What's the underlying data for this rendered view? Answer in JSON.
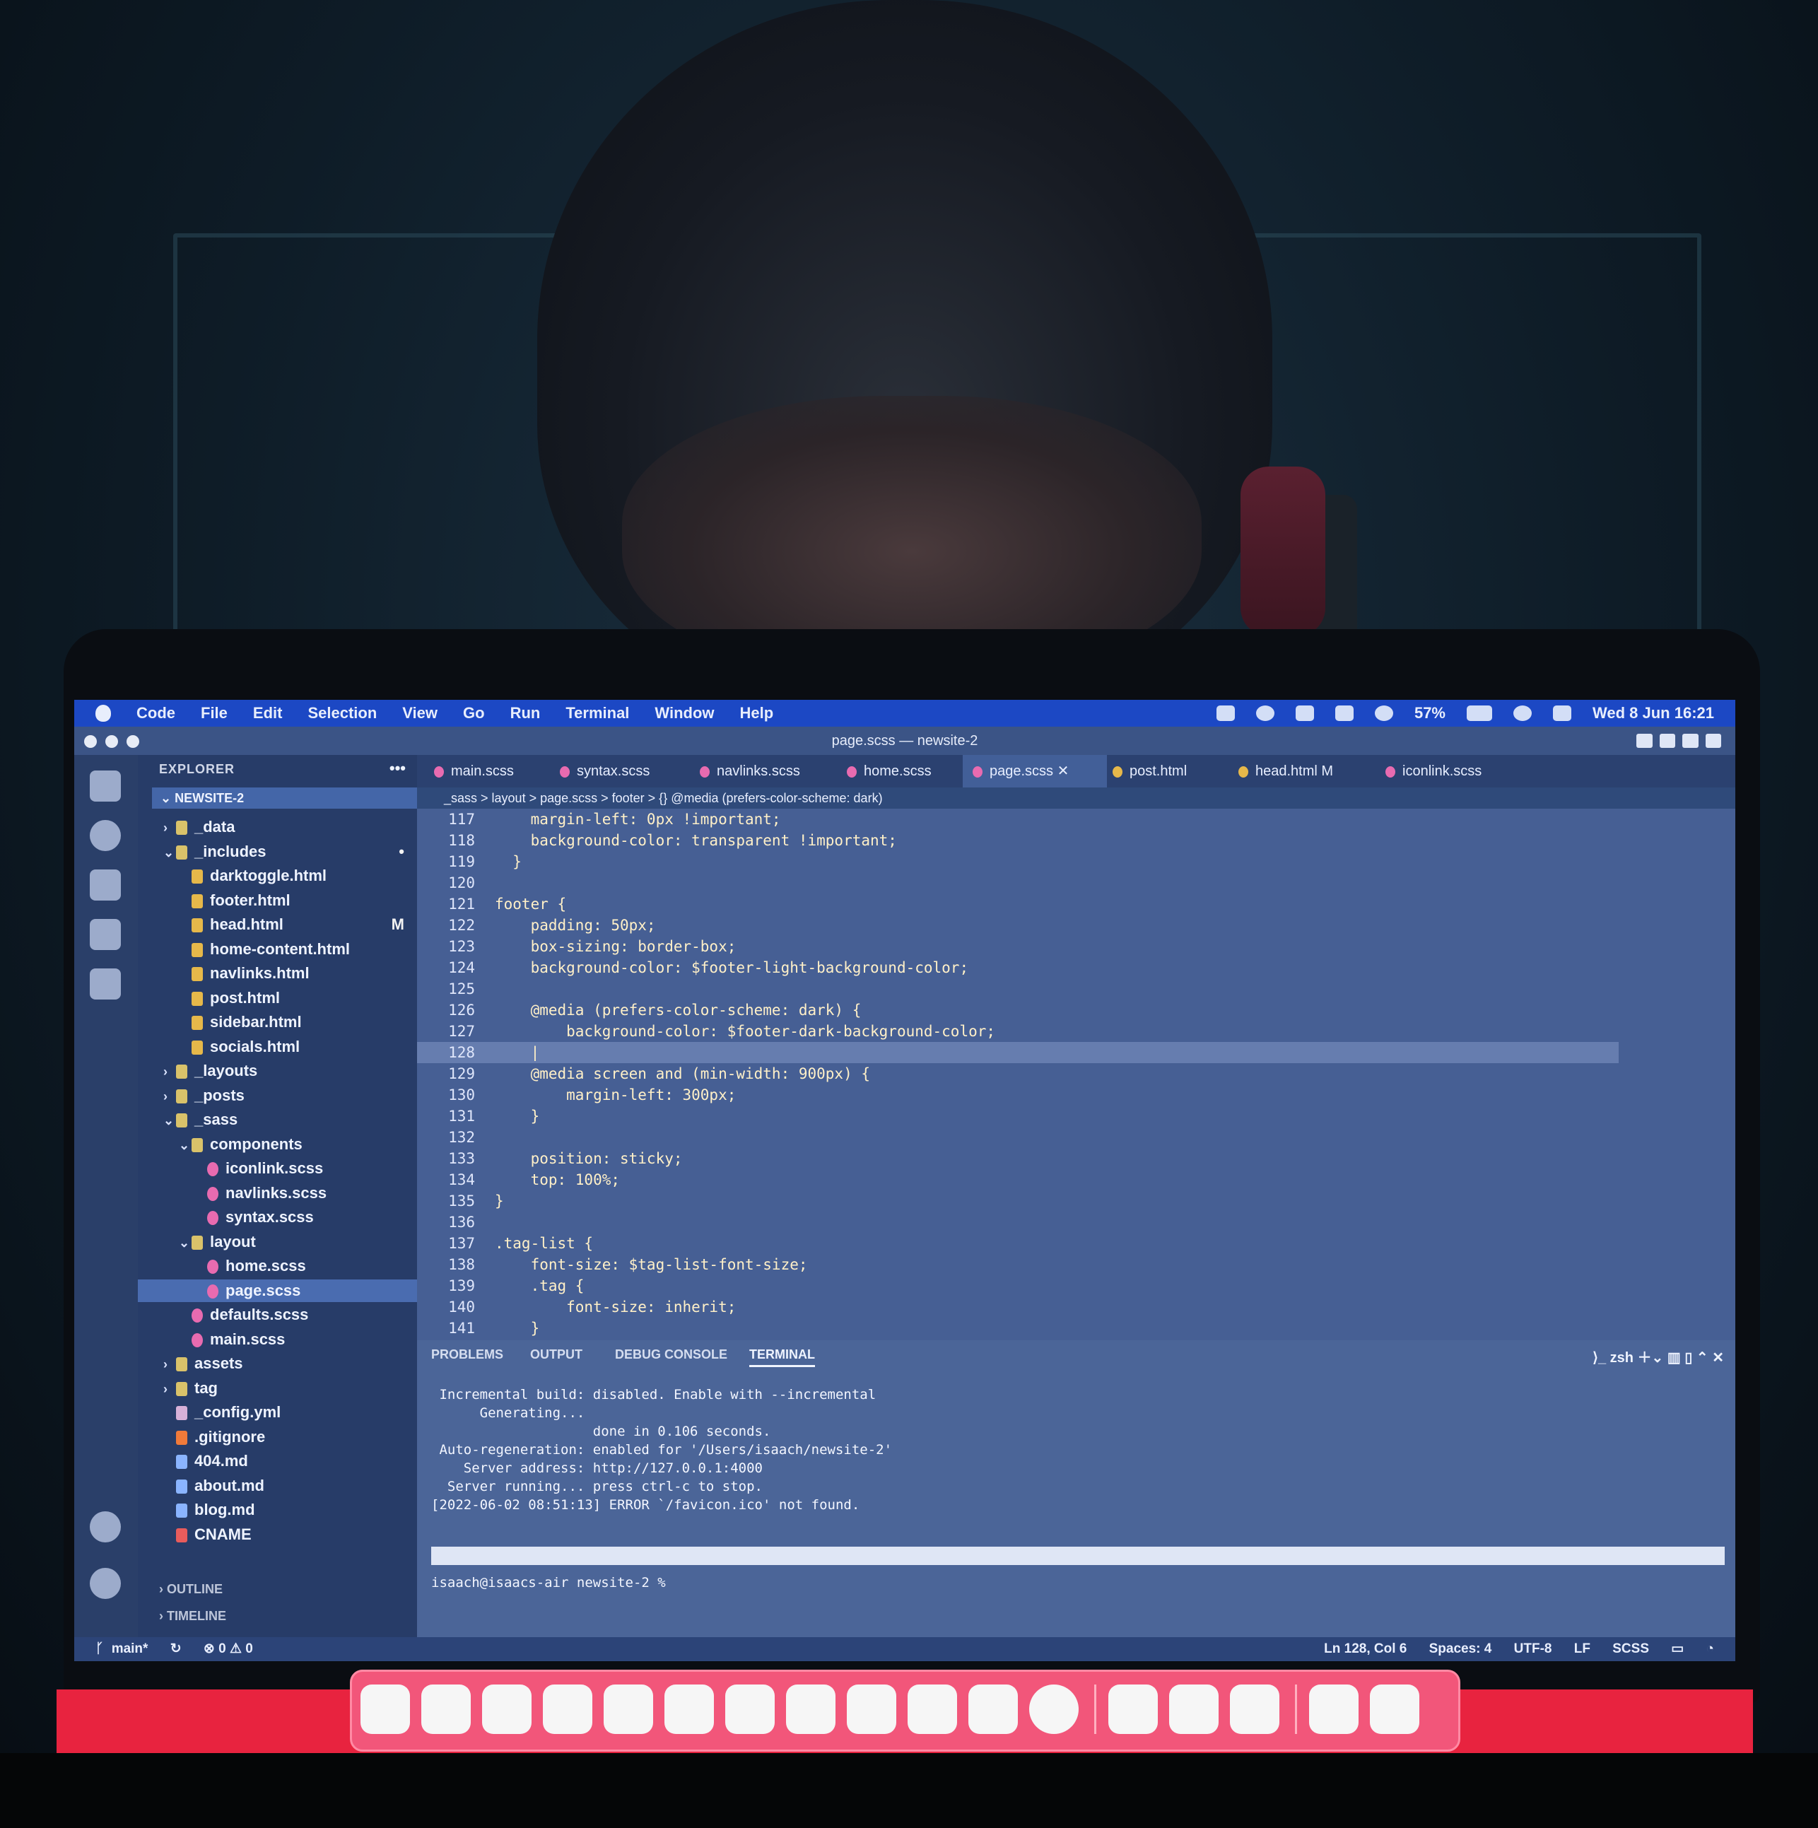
{
  "menubar": {
    "app": "Code",
    "items": [
      "File",
      "Edit",
      "Selection",
      "View",
      "Go",
      "Run",
      "Terminal",
      "Window",
      "Help"
    ],
    "battery": "57%",
    "datetime": "Wed 8 Jun  16:21"
  },
  "window": {
    "title": "page.scss — newsite-2"
  },
  "activity_bar": {
    "icons": [
      "files-icon",
      "search-icon",
      "source-control-icon",
      "run-debug-icon",
      "extensions-icon",
      "account-icon",
      "settings-gear-icon"
    ]
  },
  "sidebar": {
    "header": "EXPLORER",
    "more": "•••",
    "root": "NEWSITE-2",
    "tree": [
      {
        "label": "_data",
        "type": "folder",
        "depth": 1,
        "open": false
      },
      {
        "label": "_includes",
        "type": "folder",
        "depth": 1,
        "open": true,
        "badge": "•"
      },
      {
        "label": "darktoggle.html",
        "type": "html",
        "depth": 2
      },
      {
        "label": "footer.html",
        "type": "html",
        "depth": 2
      },
      {
        "label": "head.html",
        "type": "html",
        "depth": 2,
        "badge": "M"
      },
      {
        "label": "home-content.html",
        "type": "html",
        "depth": 2
      },
      {
        "label": "navlinks.html",
        "type": "html",
        "depth": 2
      },
      {
        "label": "post.html",
        "type": "html",
        "depth": 2
      },
      {
        "label": "sidebar.html",
        "type": "html",
        "depth": 2
      },
      {
        "label": "socials.html",
        "type": "html",
        "depth": 2
      },
      {
        "label": "_layouts",
        "type": "folder",
        "depth": 1,
        "open": false
      },
      {
        "label": "_posts",
        "type": "folder",
        "depth": 1,
        "open": false
      },
      {
        "label": "_sass",
        "type": "folder",
        "depth": 1,
        "open": true
      },
      {
        "label": "components",
        "type": "folder",
        "depth": 2,
        "open": true
      },
      {
        "label": "iconlink.scss",
        "type": "scss",
        "depth": 3
      },
      {
        "label": "navlinks.scss",
        "type": "scss",
        "depth": 3
      },
      {
        "label": "syntax.scss",
        "type": "scss",
        "depth": 3
      },
      {
        "label": "layout",
        "type": "folder",
        "depth": 2,
        "open": true
      },
      {
        "label": "home.scss",
        "type": "scss",
        "depth": 3
      },
      {
        "label": "page.scss",
        "type": "scss",
        "depth": 3,
        "selected": true
      },
      {
        "label": "defaults.scss",
        "type": "scss",
        "depth": 2
      },
      {
        "label": "main.scss",
        "type": "scss",
        "depth": 2
      },
      {
        "label": "assets",
        "type": "folder",
        "depth": 1,
        "open": false
      },
      {
        "label": "tag",
        "type": "folder",
        "depth": 1,
        "open": false
      },
      {
        "label": "_config.yml",
        "type": "yml",
        "depth": 1
      },
      {
        "label": ".gitignore",
        "type": "git",
        "depth": 1
      },
      {
        "label": "404.md",
        "type": "md",
        "depth": 1
      },
      {
        "label": "about.md",
        "type": "md",
        "depth": 1
      },
      {
        "label": "blog.md",
        "type": "md",
        "depth": 1
      },
      {
        "label": "CNAME",
        "type": "cname",
        "depth": 1
      }
    ],
    "outline": "OUTLINE",
    "timeline": "TIMELINE"
  },
  "tabs": [
    {
      "label": "main.scss",
      "type": "scss"
    },
    {
      "label": "syntax.scss",
      "type": "scss"
    },
    {
      "label": "navlinks.scss",
      "type": "scss"
    },
    {
      "label": "home.scss",
      "type": "scss"
    },
    {
      "label": "page.scss",
      "type": "scss",
      "active": true
    },
    {
      "label": "post.html",
      "type": "html"
    },
    {
      "label": "head.html M",
      "type": "html"
    },
    {
      "label": "iconlink.scss",
      "type": "scss"
    }
  ],
  "breadcrumb": "_sass > layout > page.scss > footer > {} @media (prefers-color-scheme: dark)",
  "editor": {
    "lines": [
      {
        "n": "117",
        "code": "    margin-left: 0px !important;"
      },
      {
        "n": "118",
        "code": "    background-color: transparent !important;"
      },
      {
        "n": "119",
        "code": "  }"
      },
      {
        "n": "120",
        "code": ""
      },
      {
        "n": "121",
        "code": "footer {"
      },
      {
        "n": "122",
        "code": "    padding: 50px;"
      },
      {
        "n": "123",
        "code": "    box-sizing: border-box;"
      },
      {
        "n": "124",
        "code": "    background-color: $footer-light-background-color;"
      },
      {
        "n": "125",
        "code": ""
      },
      {
        "n": "126",
        "code": "    @media (prefers-color-scheme: dark) {"
      },
      {
        "n": "127",
        "code": "        background-color: $footer-dark-background-color;"
      },
      {
        "n": "128",
        "code": "    |",
        "current": true
      },
      {
        "n": "129",
        "code": "    @media screen and (min-width: 900px) {"
      },
      {
        "n": "130",
        "code": "        margin-left: 300px;"
      },
      {
        "n": "131",
        "code": "    }"
      },
      {
        "n": "132",
        "code": ""
      },
      {
        "n": "133",
        "code": "    position: sticky;"
      },
      {
        "n": "134",
        "code": "    top: 100%;"
      },
      {
        "n": "135",
        "code": "}"
      },
      {
        "n": "136",
        "code": ""
      },
      {
        "n": "137",
        "code": ".tag-list {"
      },
      {
        "n": "138",
        "code": "    font-size: $tag-list-font-size;"
      },
      {
        "n": "139",
        "code": "    .tag {"
      },
      {
        "n": "140",
        "code": "        font-size: inherit;"
      },
      {
        "n": "141",
        "code": "    }"
      }
    ]
  },
  "panel": {
    "tabs": [
      "PROBLEMS",
      "OUTPUT",
      "DEBUG CONSOLE",
      "TERMINAL"
    ],
    "active_tab": "TERMINAL",
    "shell": "zsh",
    "terminal_lines": [
      " Incremental build: disabled. Enable with --incremental",
      "      Generating...",
      "                    done in 0.106 seconds.",
      " Auto-regeneration: enabled for '/Users/isaach/newsite-2'",
      "    Server address: http://127.0.0.1:4000",
      "  Server running... press ctrl-c to stop.",
      "[2022-06-02 08:51:13] ERROR `/favicon.ico' not found."
    ],
    "prompt": "isaach@isaacs-air newsite-2 %"
  },
  "statusbar": {
    "branch": "main*",
    "problems": "⊗ 0 ⚠ 0",
    "position": "Ln 128, Col 6",
    "spaces": "Spaces: 4",
    "encoding": "UTF-8",
    "eol": "LF",
    "language": "SCSS"
  },
  "colors": {
    "menubar": "#1c48c4",
    "editor_bg": "#465f94",
    "sidebar_bg": "#273c68",
    "dock_bg": "#f2567a"
  }
}
